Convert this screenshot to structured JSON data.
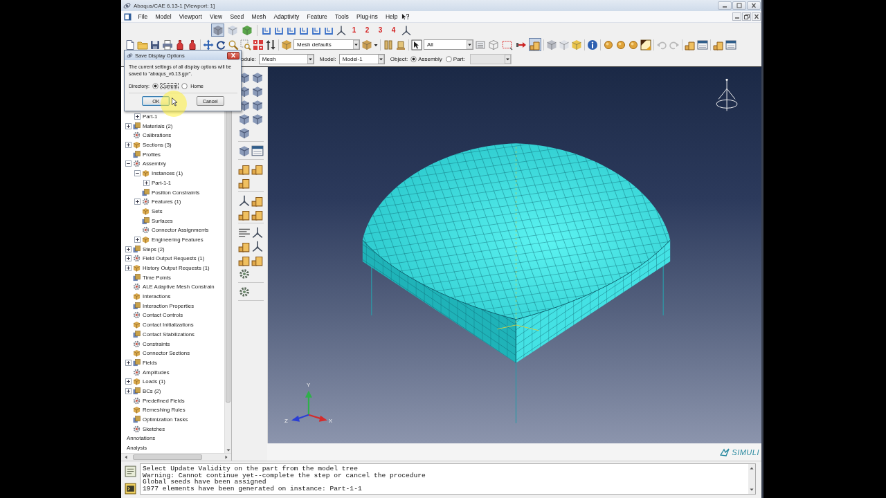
{
  "window": {
    "title": "Abaqus/CAE 6.13-1 [Viewport: 1]"
  },
  "menu_bar": [
    "File",
    "Model",
    "Viewport",
    "View",
    "Seed",
    "Mesh",
    "Adaptivity",
    "Feature",
    "Tools",
    "Plug-ins",
    "Help"
  ],
  "view_toolbar": {
    "render_styles": [
      {
        "selected": true
      },
      {
        "selected": false
      },
      {
        "selected": false
      }
    ],
    "view_buttons": [
      "1",
      "2",
      "3",
      "4"
    ]
  },
  "main_toolbar": {
    "mesh_defaults": "Mesh defaults",
    "selection_filter": "All",
    "selection_tools": [
      {
        "selected": false
      },
      {
        "selected": false
      },
      {
        "selected": false
      },
      {
        "selected": true
      }
    ]
  },
  "context_bar": {
    "module_label": "odule:",
    "module": "Mesh",
    "model_label": "Model:",
    "model": "Model-1",
    "object_label": "Object:",
    "object_options": [
      {
        "label": "Assembly",
        "selected": true
      },
      {
        "label": "Part:",
        "selected": false
      }
    ],
    "part_dropdown": {
      "disabled": true
    }
  },
  "model_tree": {
    "items": [
      {
        "kind": "covered",
        "children": [
          {
            "kind": "instance",
            "label": "Part-1",
            "expanded": false
          }
        ]
      },
      {
        "kind": "container",
        "label": "Materials (2)",
        "expanded": false
      },
      {
        "kind": "container",
        "label": "Calibrations"
      },
      {
        "kind": "container",
        "label": "Sections (3)",
        "expanded": false
      },
      {
        "kind": "container",
        "label": "Profiles"
      },
      {
        "kind": "container",
        "label": "Assembly",
        "expanded": true,
        "children": [
          {
            "kind": "container",
            "label": "Instances (1)",
            "expanded": true,
            "children": [
              {
                "kind": "instance",
                "label": "Part-1-1",
                "expanded": false
              }
            ]
          },
          {
            "kind": "container",
            "label": "Position Constraints"
          },
          {
            "kind": "container",
            "label": "Features (1)",
            "expanded": false
          },
          {
            "kind": "container",
            "label": "Sets"
          },
          {
            "kind": "container",
            "label": "Surfaces"
          },
          {
            "kind": "container",
            "label": "Connector Assignments"
          },
          {
            "kind": "container",
            "label": "Engineering Features",
            "expanded": false
          }
        ]
      },
      {
        "kind": "container",
        "label": "Steps (2)",
        "expanded": false
      },
      {
        "kind": "container",
        "label": "Field Output Requests (1)",
        "expanded": false
      },
      {
        "kind": "container",
        "label": "History Output Requests (1)",
        "expanded": false
      },
      {
        "kind": "container",
        "label": "Time Points"
      },
      {
        "kind": "container",
        "label": "ALE Adaptive Mesh Constrain"
      },
      {
        "kind": "container",
        "label": "Interactions"
      },
      {
        "kind": "container",
        "label": "Interaction Properties"
      },
      {
        "kind": "container",
        "label": "Contact Controls"
      },
      {
        "kind": "container",
        "label": "Contact Initializations"
      },
      {
        "kind": "container",
        "label": "Contact Stabilizations"
      },
      {
        "kind": "container",
        "label": "Constraints"
      },
      {
        "kind": "container",
        "label": "Connector Sections"
      },
      {
        "kind": "container",
        "label": "Fields",
        "expanded": false
      },
      {
        "kind": "container",
        "label": "Amplitudes"
      },
      {
        "kind": "container",
        "label": "Loads (1)",
        "expanded": false
      },
      {
        "kind": "container",
        "label": "BCs (2)",
        "expanded": false
      },
      {
        "kind": "container",
        "label": "Predefined Fields"
      },
      {
        "kind": "container",
        "label": "Remeshing Rules"
      },
      {
        "kind": "container",
        "label": "Optimization Tasks"
      },
      {
        "kind": "container",
        "label": "Sketches"
      },
      {
        "kind": "section",
        "label": "Annotations"
      },
      {
        "kind": "section",
        "label": "Analysis"
      }
    ]
  },
  "dialog": {
    "title": "Save Display Options",
    "message": "The current settings of all display options will be saved to \"abaqus_v6.13.gpr\".",
    "directory_label": "Directory:",
    "directory_options": [
      {
        "label": "Current",
        "selected": true,
        "focused": true
      },
      {
        "label": "Home",
        "selected": false,
        "focused": false
      }
    ],
    "buttons": [
      {
        "label": "OK",
        "focused": true
      },
      {
        "label": "Cancel",
        "focused": false
      }
    ]
  },
  "viewport": {
    "triad_labels": [
      "Y",
      "Z",
      "X"
    ],
    "logo_text": "SIMULI"
  },
  "message_area": {
    "lines": [
      "Select Update Validity on the part from the model tree",
      "Warning: Cannot continue yet--complete the step or cancel the procedure",
      "Global seeds have been assigned",
      "1977 elements have been generated on instance: Part-1-1"
    ]
  }
}
